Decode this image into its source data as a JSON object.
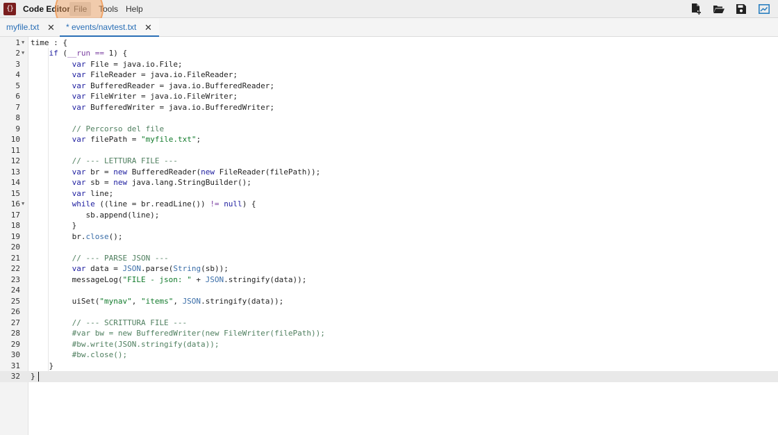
{
  "app": {
    "title": "Code Editor",
    "logo_text": "{}"
  },
  "menu": {
    "file": "File",
    "tools": "Tools",
    "help": "Help"
  },
  "toolbar": {
    "icons": [
      "new-file-icon",
      "open-folder-icon",
      "save-icon",
      "preview-icon"
    ]
  },
  "tabs": [
    {
      "label": "myfile.txt",
      "close": "✕",
      "active": false
    },
    {
      "label": "* events/navtest.txt",
      "close": "✕",
      "active": true
    }
  ],
  "colors": {
    "accent": "#2a6fb6",
    "logo": "#7a1e1e",
    "keyword": "#2020a0",
    "string": "#117a2b",
    "comment": "#4f7f5f"
  },
  "editor": {
    "active_line": 32,
    "lines": [
      {
        "n": "1",
        "text": "time : {"
      },
      {
        "n": "2",
        "text": "    if (__run == 1) {"
      },
      {
        "n": "3",
        "text": "         var File = java.io.File;"
      },
      {
        "n": "4",
        "text": "         var FileReader = java.io.FileReader;"
      },
      {
        "n": "5",
        "text": "         var BufferedReader = java.io.BufferedReader;"
      },
      {
        "n": "6",
        "text": "         var FileWriter = java.io.FileWriter;"
      },
      {
        "n": "7",
        "text": "         var BufferedWriter = java.io.BufferedWriter;"
      },
      {
        "n": "8",
        "text": ""
      },
      {
        "n": "9",
        "text": "         // Percorso del file"
      },
      {
        "n": "10",
        "text": "         var filePath = \"myfile.txt\";"
      },
      {
        "n": "11",
        "text": ""
      },
      {
        "n": "12",
        "text": "         // --- LETTURA FILE ---"
      },
      {
        "n": "13",
        "text": "         var br = new BufferedReader(new FileReader(filePath));"
      },
      {
        "n": "14",
        "text": "         var sb = new java.lang.StringBuilder();"
      },
      {
        "n": "15",
        "text": "         var line;"
      },
      {
        "n": "16",
        "text": "         while ((line = br.readLine()) != null) {"
      },
      {
        "n": "17",
        "text": "            sb.append(line);"
      },
      {
        "n": "18",
        "text": "         }"
      },
      {
        "n": "19",
        "text": "         br.close();"
      },
      {
        "n": "20",
        "text": ""
      },
      {
        "n": "21",
        "text": "         // --- PARSE JSON ---"
      },
      {
        "n": "22",
        "text": "         var data = JSON.parse(String(sb));"
      },
      {
        "n": "23",
        "text": "         messageLog(\"FILE - json: \" + JSON.stringify(data));"
      },
      {
        "n": "24",
        "text": ""
      },
      {
        "n": "25",
        "text": "         uiSet(\"mynav\", \"items\", JSON.stringify(data));"
      },
      {
        "n": "26",
        "text": ""
      },
      {
        "n": "27",
        "text": "         // --- SCRITTURA FILE ---"
      },
      {
        "n": "28",
        "text": "         #var bw = new BufferedWriter(new FileWriter(filePath));"
      },
      {
        "n": "29",
        "text": "         #bw.write(JSON.stringify(data));"
      },
      {
        "n": "30",
        "text": "         #bw.close();"
      },
      {
        "n": "31",
        "text": "    }"
      },
      {
        "n": "32",
        "text": "}"
      }
    ]
  }
}
